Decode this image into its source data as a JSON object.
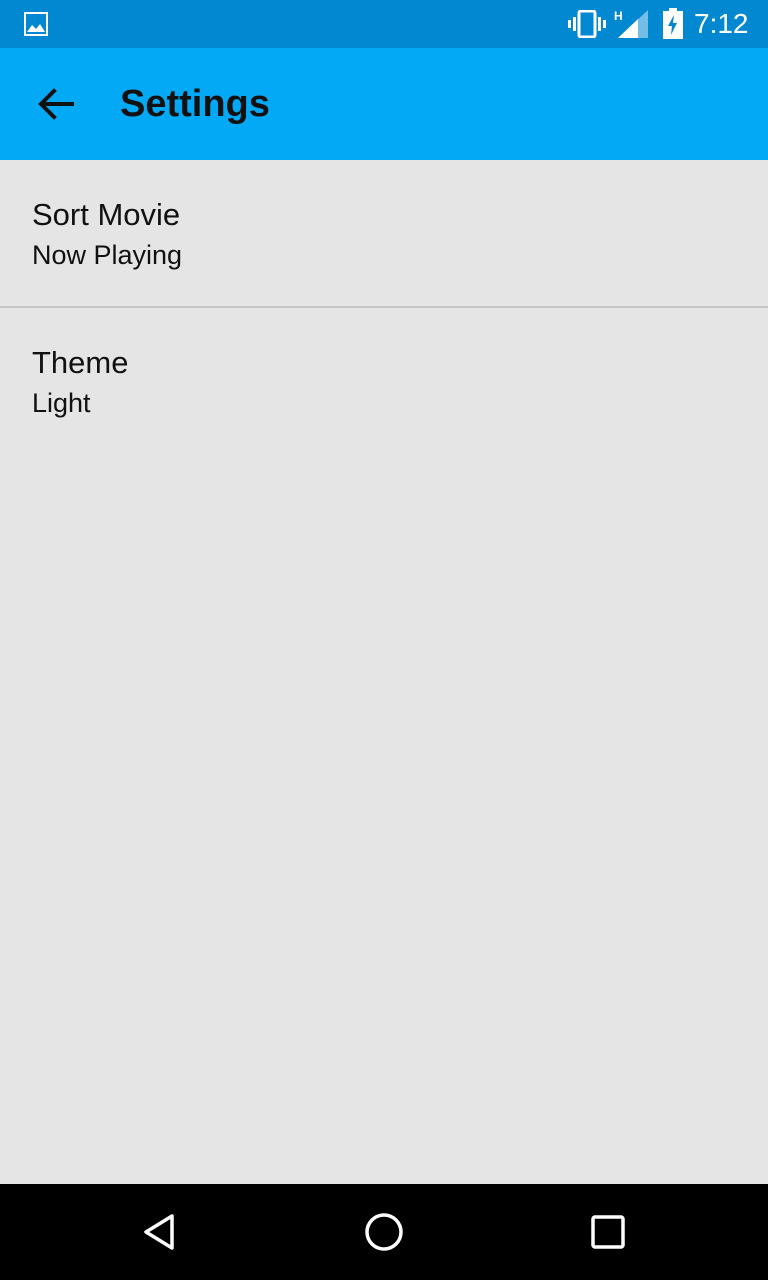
{
  "status_bar": {
    "time": "7:12",
    "network_type": "H",
    "icons": [
      "gallery-icon",
      "vibrate-icon",
      "signal-icon",
      "battery-charging-icon"
    ]
  },
  "app_bar": {
    "title": "Settings",
    "back_icon": "arrow-left-icon",
    "color": "#03a9f4"
  },
  "preferences": [
    {
      "title": "Sort Movie",
      "summary": "Now Playing"
    },
    {
      "title": "Theme",
      "summary": "Light"
    }
  ],
  "nav_bar": {
    "icons": [
      "back-triangle-icon",
      "home-circle-icon",
      "recents-square-icon"
    ]
  },
  "colors": {
    "status_bar": "#0288d1",
    "app_bar": "#03a9f4",
    "background": "#e5e5e5",
    "divider": "#c6c6c6",
    "nav_bar": "#000000"
  }
}
